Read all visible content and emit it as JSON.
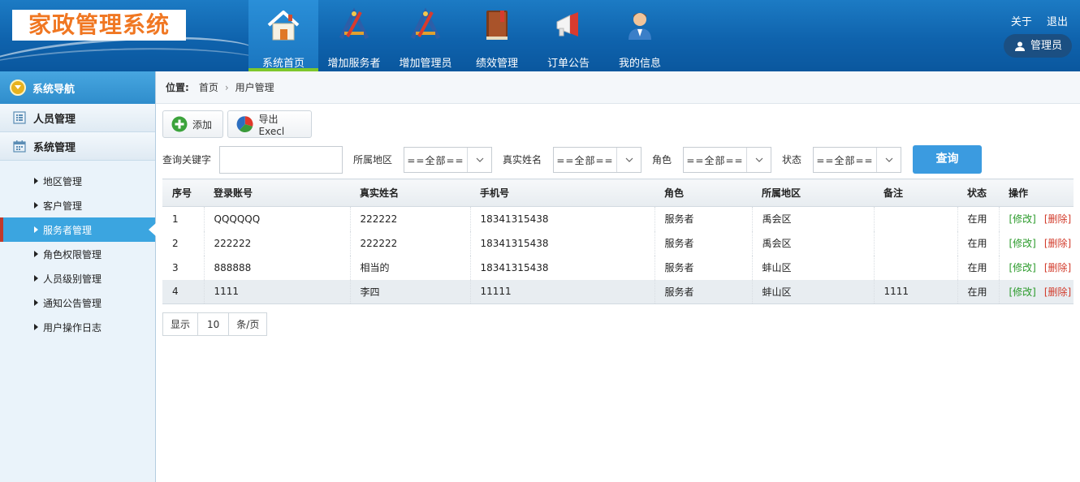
{
  "app": {
    "logo_text": "家政管理系统",
    "colors": {
      "header": "#0f63ad",
      "logo_text": "#f07722",
      "active_tab_underline": "#7ec72c",
      "active_sidebar": "#3ba5e0",
      "query_button": "#3b9be0",
      "edit": "#2a9a2a",
      "delete": "#d23b2b"
    }
  },
  "nav": [
    {
      "label": "系统首页",
      "icon": "house-icon",
      "active": true
    },
    {
      "label": "增加服务者",
      "icon": "drafting-tools-icon"
    },
    {
      "label": "增加管理员",
      "icon": "drafting-tools-icon"
    },
    {
      "label": "绩效管理",
      "icon": "book-icon"
    },
    {
      "label": "订单公告",
      "icon": "megaphone-icon"
    },
    {
      "label": "我的信息",
      "icon": "user-icon"
    }
  ],
  "top_links": {
    "about": "关于",
    "logout": "退出",
    "admin": "管理员"
  },
  "sidebar": {
    "title": "系统导航",
    "groups": [
      {
        "label": "人员管理",
        "icon": "list-icon"
      },
      {
        "label": "系统管理",
        "icon": "calendar-icon"
      }
    ],
    "items": [
      {
        "label": "地区管理"
      },
      {
        "label": "客户管理"
      },
      {
        "label": "服务者管理",
        "active": true
      },
      {
        "label": "角色权限管理"
      },
      {
        "label": "人员级别管理"
      },
      {
        "label": "通知公告管理"
      },
      {
        "label": "用户操作日志"
      }
    ]
  },
  "breadcrumb": {
    "prefix": "位置:",
    "home": "首页",
    "current": "用户管理"
  },
  "toolbar": {
    "add": "添加",
    "export": "导出Execl"
  },
  "filters": {
    "keyword_label": "查询关键字",
    "keyword_value": "",
    "region_label": "所属地区",
    "region_value": "==全部==",
    "realname_label": "真实姓名",
    "realname_value": "==全部==",
    "role_label": "角色",
    "role_value": "==全部==",
    "status_label": "状态",
    "status_value": "==全部==",
    "query_button": "查询"
  },
  "table": {
    "headers": [
      "序号",
      "登录账号",
      "真实姓名",
      "手机号",
      "角色",
      "所属地区",
      "备注",
      "状态",
      "操作"
    ],
    "edit_label": "[修改]",
    "delete_label": "[删除]",
    "rows": [
      {
        "no": "1",
        "account": "QQQQQQ",
        "realname": "222222",
        "phone": "18341315438",
        "role": "服务者",
        "region": "禹会区",
        "note": "",
        "status": "在用"
      },
      {
        "no": "2",
        "account": "222222",
        "realname": "222222",
        "phone": "18341315438",
        "role": "服务者",
        "region": "禹会区",
        "note": "",
        "status": "在用"
      },
      {
        "no": "3",
        "account": "888888",
        "realname": "相当的",
        "phone": "18341315438",
        "role": "服务者",
        "region": "蚌山区",
        "note": "",
        "status": "在用"
      },
      {
        "no": "4",
        "account": "1111",
        "realname": "李四",
        "phone": "11111",
        "role": "服务者",
        "region": "蚌山区",
        "note": "1111",
        "status": "在用",
        "highlighted": true
      }
    ]
  },
  "pager": {
    "show": "显示",
    "size": "10",
    "unit": "条/页"
  }
}
